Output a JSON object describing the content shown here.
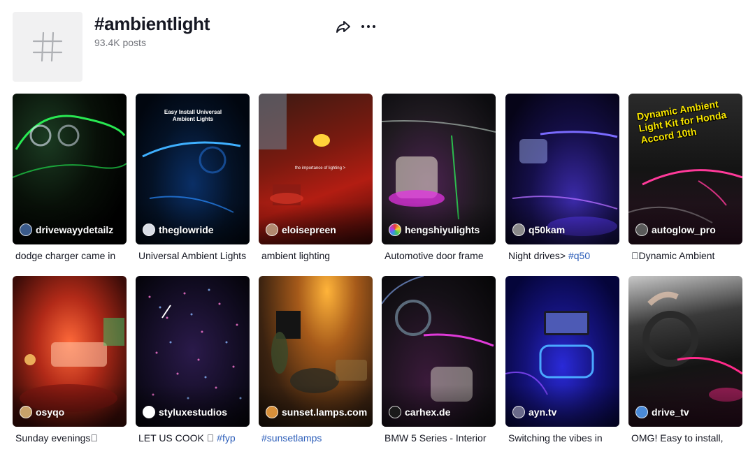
{
  "hashtag": {
    "title": "#ambientlight",
    "posts_count": "93.4K posts",
    "icon": "hash-icon"
  },
  "actions": {
    "share_icon": "share-icon",
    "more_icon": "more-options-icon"
  },
  "videos": [
    {
      "author": "drivewayydetailz",
      "caption": "dodge charger came in",
      "hashtag": "",
      "overlay": ""
    },
    {
      "author": "theglowride",
      "caption": "Universal Ambient Lights",
      "hashtag": "",
      "overlay": "Easy Install Universal Ambient Lights"
    },
    {
      "author": "eloisepreen",
      "caption": "ambient lighting",
      "hashtag": "",
      "overlay": "the importance of lighting >"
    },
    {
      "author": "hengshiyulights",
      "caption": "Automotive door frame",
      "hashtag": "",
      "overlay": ""
    },
    {
      "author": "q50kam",
      "caption": "Night drives> ",
      "hashtag": "#q50",
      "overlay": ""
    },
    {
      "author": "autoglow_pro",
      "caption": "\u0000Dynamic Ambient",
      "hashtag": "",
      "overlay": "Dynamic Ambient Light Kit for Honda Accord 10th"
    },
    {
      "author": "osyqo",
      "caption": "Sunday evenings\u0000",
      "hashtag": "",
      "overlay": ""
    },
    {
      "author": "styluxestudios",
      "caption": "LET US COOK \u0000 ",
      "hashtag": "#fyp",
      "overlay": ""
    },
    {
      "author": "sunset.lamps.com",
      "caption": "",
      "hashtag": "#sunsetlamps",
      "overlay": ""
    },
    {
      "author": "carhex.de",
      "caption": "BMW 5 Series - Interior",
      "hashtag": "",
      "overlay": ""
    },
    {
      "author": "ayn.tv",
      "caption": "Switching the vibes in",
      "hashtag": "",
      "overlay": ""
    },
    {
      "author": "drive_tv",
      "caption": "OMG! Easy to install,",
      "hashtag": "",
      "overlay": ""
    }
  ]
}
